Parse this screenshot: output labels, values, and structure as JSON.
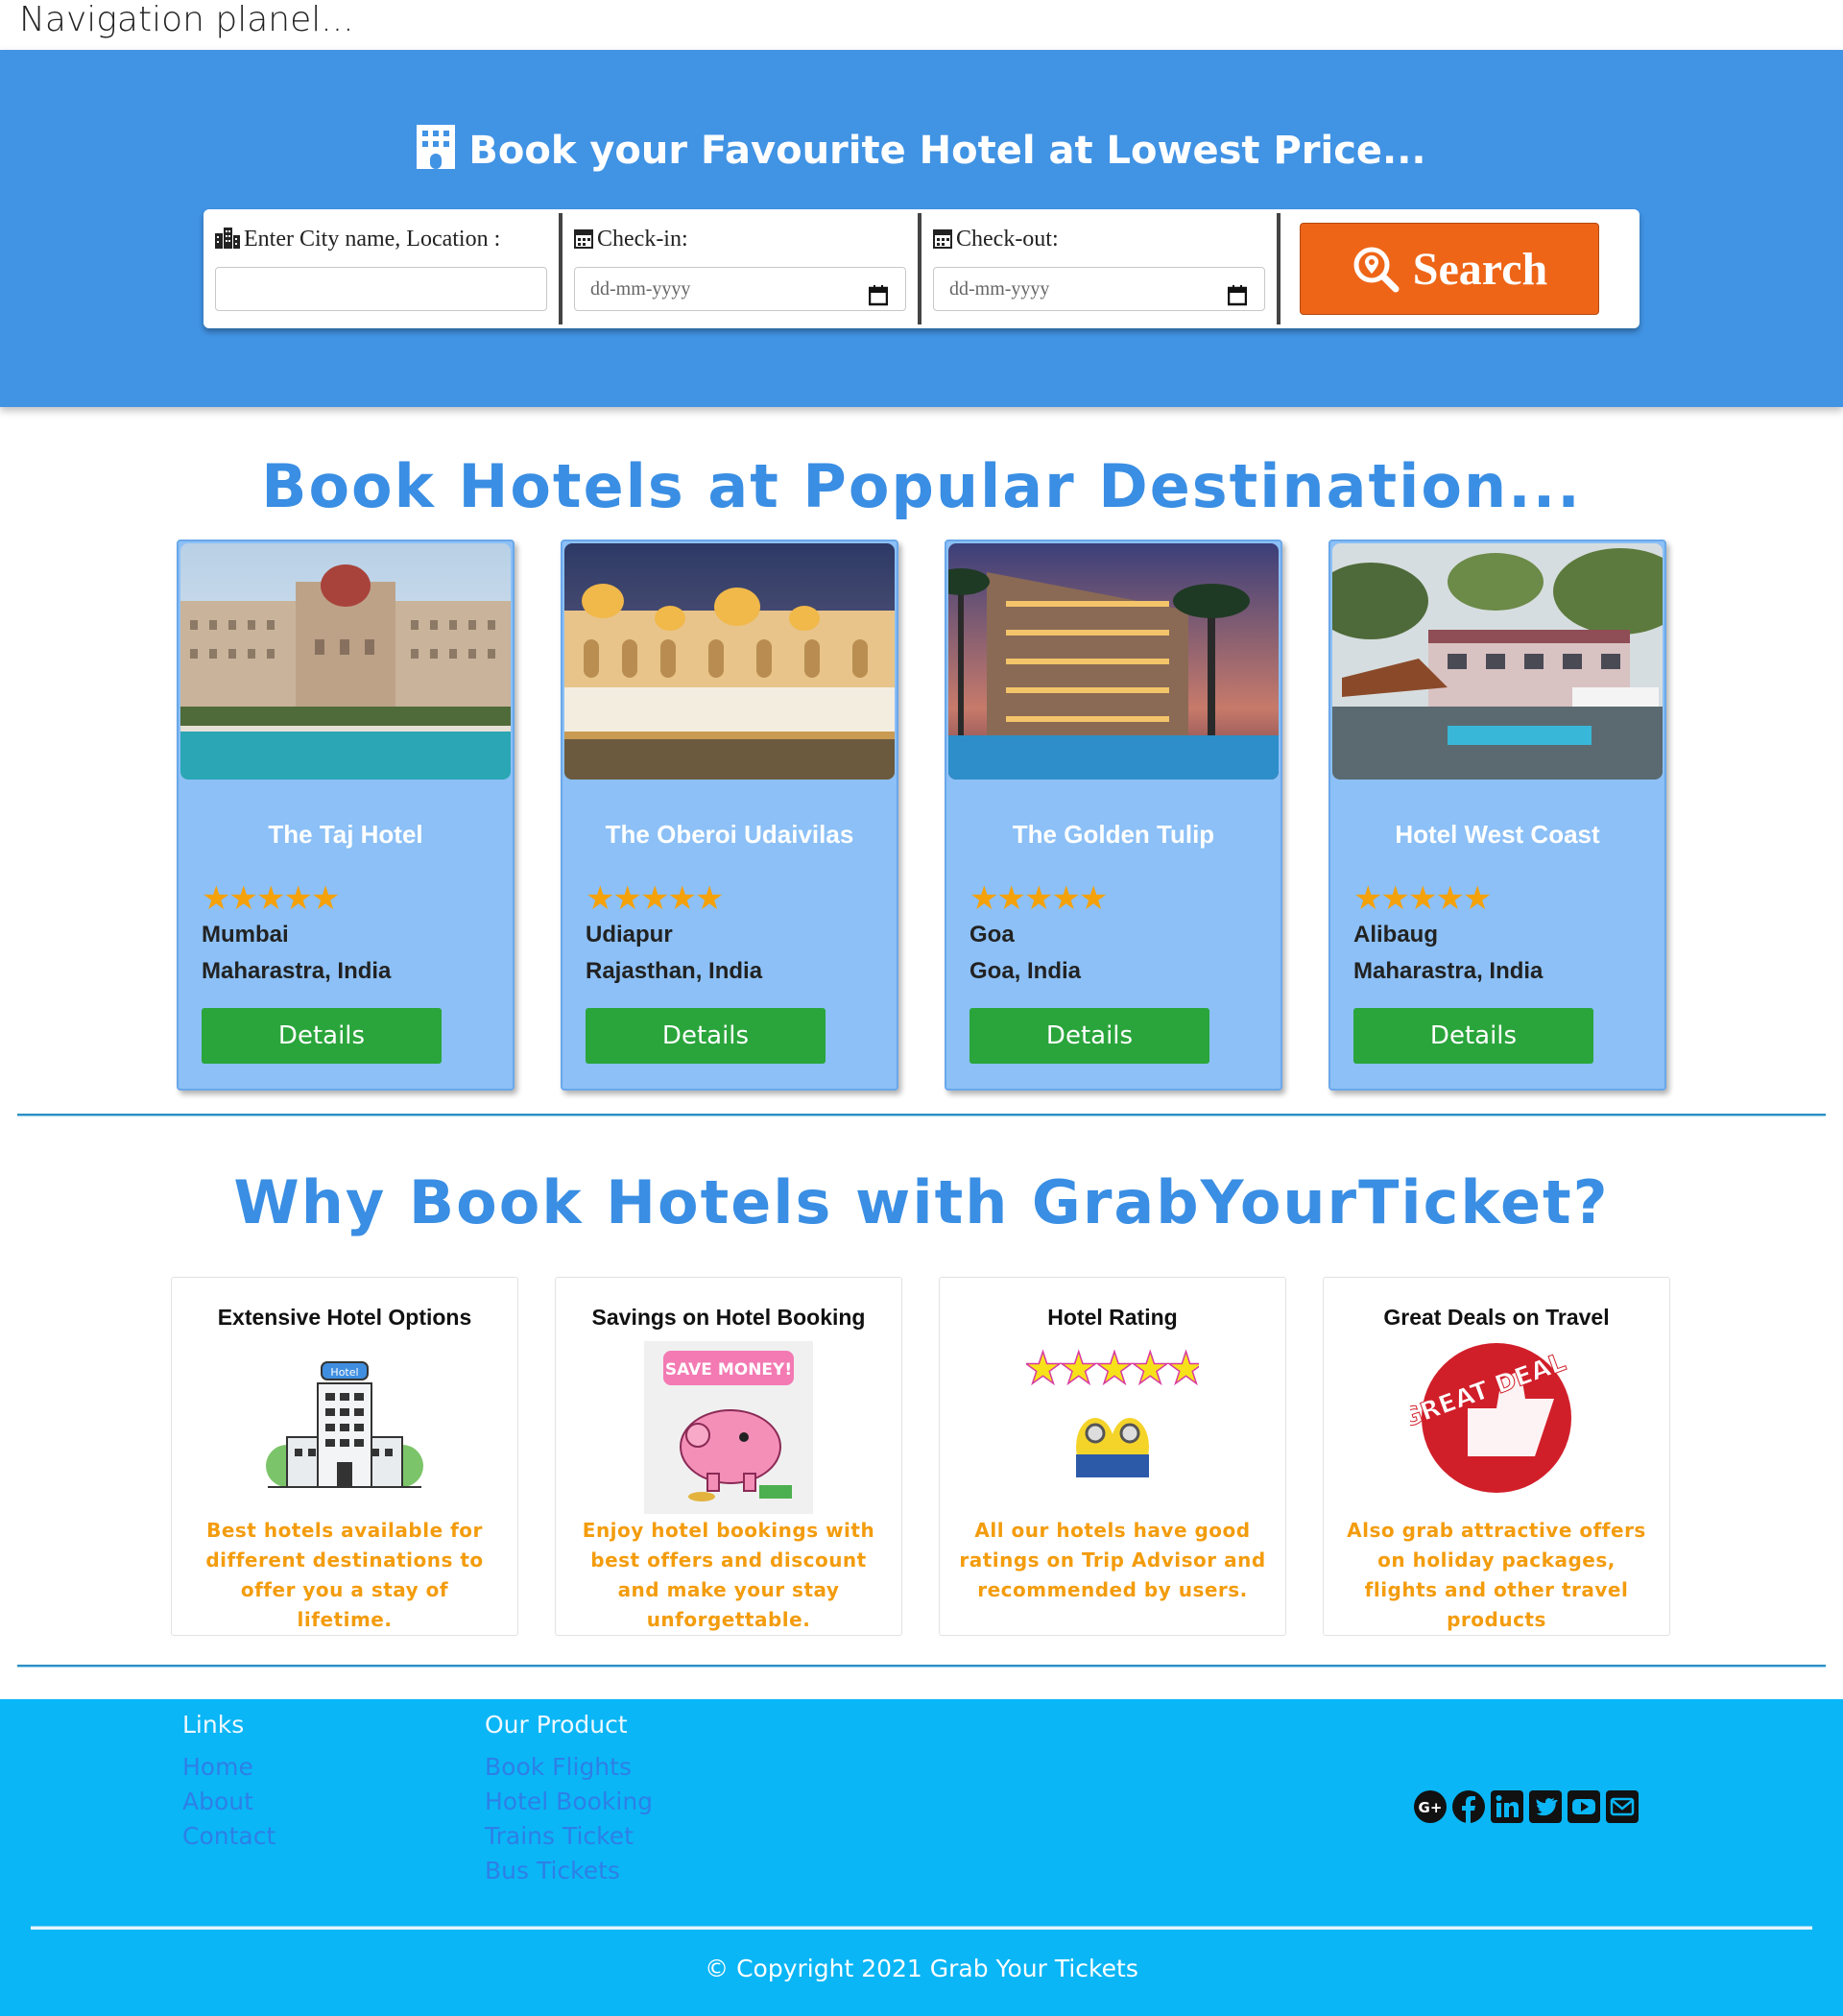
{
  "nav": {
    "text": "Navigation planel..."
  },
  "hero": {
    "title": "Book your Favourite Hotel at Lowest Price...",
    "city_label": "Enter City name, Location :",
    "city_value": "",
    "checkin_label": "Check-in:",
    "checkin_placeholder": "dd-mm-yyyy",
    "checkout_label": "Check-out:",
    "checkout_placeholder": "dd-mm-yyyy",
    "search_label": "Search"
  },
  "popular": {
    "title": "Book Hotels at Popular Destination...",
    "hotels": [
      {
        "name": "The Taj Hotel",
        "stars": "★★★★★",
        "city": "Mumbai",
        "state": "Maharastra, India",
        "button": "Details"
      },
      {
        "name": "The Oberoi Udaivilas",
        "stars": "★★★★★",
        "city": "Udiapur",
        "state": "Rajasthan, India",
        "button": "Details"
      },
      {
        "name": "The Golden Tulip",
        "stars": "★★★★★",
        "city": "Goa",
        "state": "Goa, India",
        "button": "Details"
      },
      {
        "name": "Hotel West Coast",
        "stars": "★★★★★",
        "city": "Alibaug",
        "state": "Maharastra, India",
        "button": "Details"
      }
    ]
  },
  "why": {
    "title": "Why Book Hotels with GrabYourTicket?",
    "cards": [
      {
        "title": "Extensive Hotel Options",
        "desc": "Best hotels available for different destinations to offer you a stay of lifetime.",
        "img_text": "Hotel"
      },
      {
        "title": "Savings on Hotel Booking",
        "desc": "Enjoy hotel bookings with best offers and discount and make your stay unforgettable.",
        "img_text": "SAVE MONEY!"
      },
      {
        "title": "Hotel Rating",
        "desc": "All our hotels have good ratings on Trip Advisor and recommended by users.",
        "img_text": "★★★★★"
      },
      {
        "title": "Great Deals on Travel",
        "desc": "Also grab attractive offers on holiday packages, flights and other travel products",
        "img_text": "GREAT DEAL"
      }
    ]
  },
  "footer": {
    "links_heading": "Links",
    "links": [
      "Home",
      "About",
      "Contact"
    ],
    "product_heading": "Our Product",
    "products": [
      "Book Flights",
      "Hotel Booking",
      "Trains Ticket",
      "Bus Tickets"
    ],
    "social": [
      "google-plus-icon",
      "facebook-icon",
      "linkedin-icon",
      "twitter-icon",
      "youtube-icon",
      "email-icon"
    ],
    "copyright": "© Copyright 2021 Grab Your Tickets"
  },
  "colors": {
    "hero": "#4193e4",
    "title_blue": "#3a8ee3",
    "card": "#8cc0f6",
    "button_green": "#2aa53b",
    "search_orange": "#ee6517",
    "footer": "#0ab6f6",
    "desc_orange": "#f39c0d"
  }
}
